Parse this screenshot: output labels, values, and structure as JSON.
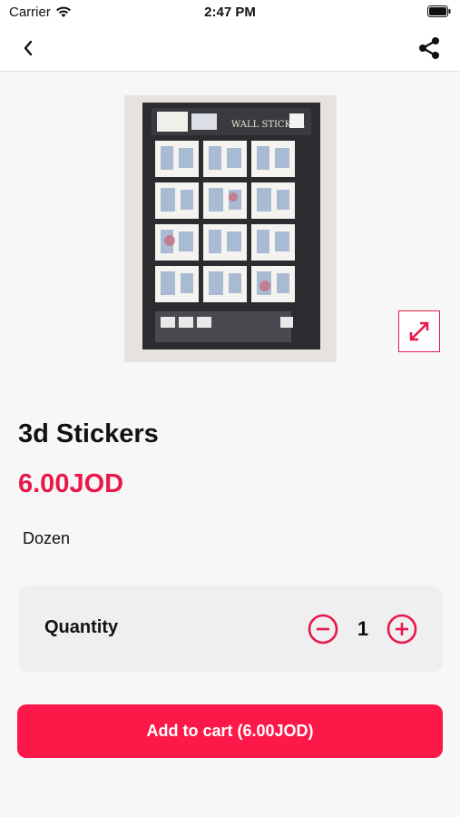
{
  "status_bar": {
    "carrier": "Carrier",
    "time": "2:47 PM"
  },
  "nav": {
    "back_icon": "chevron-left-icon",
    "share_icon": "share-icon"
  },
  "product": {
    "title": "3d Stickers",
    "price": "6.00JOD",
    "unit": "Dozen",
    "image_header_text": "WALL STICKER"
  },
  "quantity": {
    "label": "Quantity",
    "value": "1"
  },
  "cart": {
    "button_label": "Add to cart (6.00JOD)"
  },
  "colors": {
    "accent": "#e8194a",
    "button": "#fc1848",
    "card": "#efeff1",
    "background": "#f7f7f7"
  }
}
